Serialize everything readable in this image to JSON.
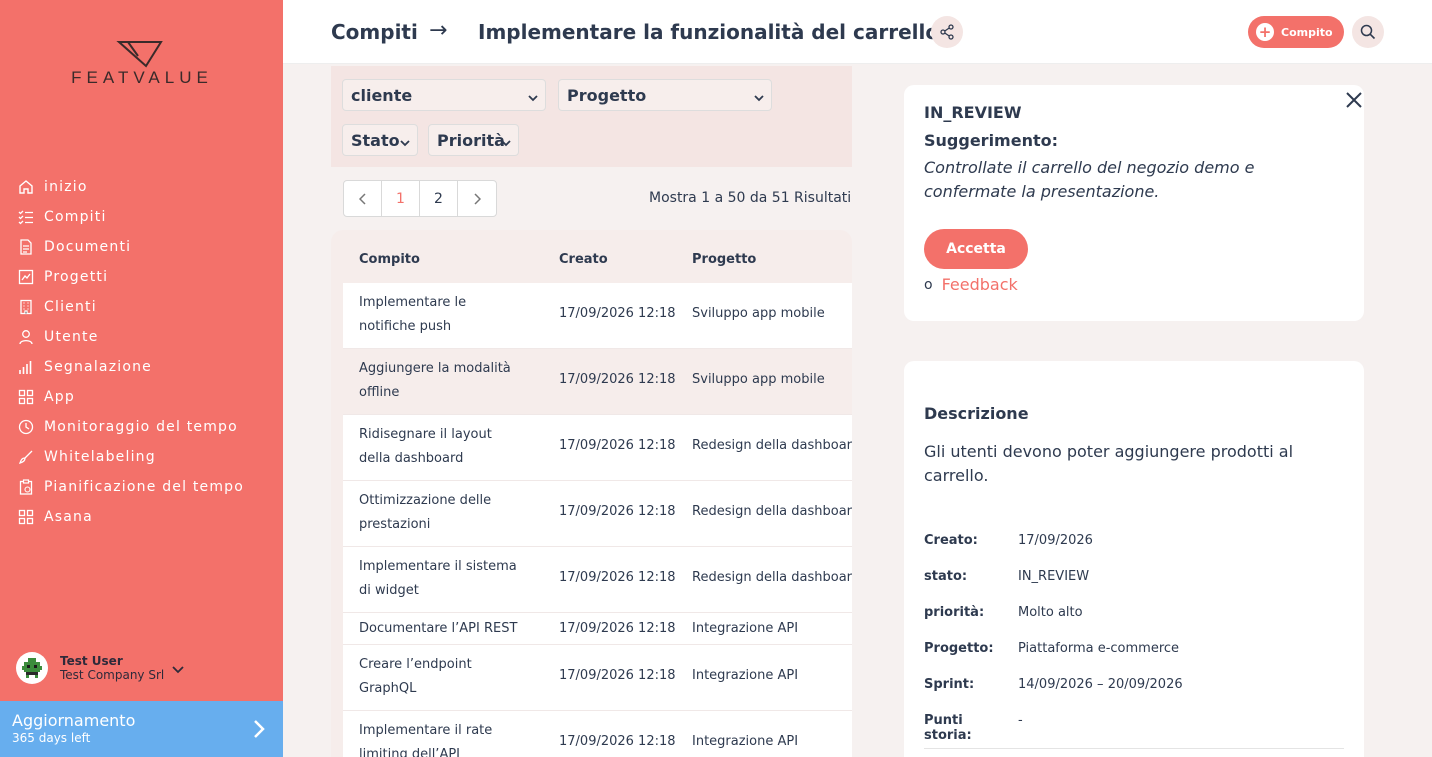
{
  "brand": {
    "name": "FEATVALUE",
    "accent": "#f3716a",
    "upgrade_color": "#67aeee"
  },
  "sidebar": {
    "items": [
      {
        "label": "inizio",
        "icon": "home-icon"
      },
      {
        "label": "Compiti",
        "icon": "checklist-icon"
      },
      {
        "label": "Documenti",
        "icon": "document-icon"
      },
      {
        "label": "Progetti",
        "icon": "chart-board-icon"
      },
      {
        "label": "Clienti",
        "icon": "building-icon"
      },
      {
        "label": "Utente",
        "icon": "user-icon"
      },
      {
        "label": "Segnalazione",
        "icon": "bar-chart-icon"
      },
      {
        "label": "App",
        "icon": "apps-icon"
      },
      {
        "label": "Monitoraggio del tempo",
        "icon": "clock-icon"
      },
      {
        "label": "Whitelabeling",
        "icon": "brush-icon"
      },
      {
        "label": "Pianificazione del tempo",
        "icon": "clipboard-icon"
      },
      {
        "label": "Asana",
        "icon": "apps-icon"
      }
    ],
    "user": {
      "name": "Test User",
      "company": "Test Company Srl"
    },
    "upgrade": {
      "title": "Aggiornamento",
      "subtitle": "365 days left"
    }
  },
  "header": {
    "root": "Compiti",
    "arrow": "→",
    "title": "Implementare la funzionalità del carrello",
    "add_label": "Compito"
  },
  "filters": {
    "client": "cliente",
    "project": "Progetto",
    "status": "Stato",
    "priority": "Priorità"
  },
  "pagination": {
    "prev": "‹",
    "pages": [
      "1",
      "2"
    ],
    "next": "›",
    "summary": "Mostra 1 a 50 da 51 Risultati"
  },
  "table": {
    "columns": [
      "Compito",
      "Creato",
      "Progetto"
    ],
    "rows": [
      {
        "task": "Implementare le notifiche push",
        "created": "17/09/2026 12:18",
        "project": "Sviluppo app mobile",
        "lines": 2
      },
      {
        "task": "Aggiungere la modalità offline",
        "created": "17/09/2026 12:18",
        "project": "Sviluppo app mobile",
        "lines": 2
      },
      {
        "task": "Ridisegnare il layout della dashboard",
        "created": "17/09/2026 12:18",
        "project": "Redesign della dashboard",
        "lines": 2
      },
      {
        "task": "Ottimizzazione delle prestazioni",
        "created": "17/09/2026 12:18",
        "project": "Redesign della dashboard",
        "lines": 2
      },
      {
        "task": "Implementare il sistema di widget",
        "created": "17/09/2026 12:18",
        "project": "Redesign della dashboard",
        "lines": 2
      },
      {
        "task": "Documentare l’API REST",
        "created": "17/09/2026 12:18",
        "project": "Integrazione API",
        "lines": 1
      },
      {
        "task": "Creare l’endpoint GraphQL",
        "created": "17/09/2026 12:18",
        "project": "Integrazione API",
        "lines": 2
      },
      {
        "task": "Implementare il rate limiting dell’API",
        "created": "17/09/2026 12:18",
        "project": "Integrazione API",
        "lines": 2
      }
    ]
  },
  "suggestion": {
    "status": "IN_REVIEW",
    "title": "Suggerimento:",
    "text": "Controllate il carrello del negozio demo e confermate la presentazione.",
    "accept_label": "Accetta",
    "bullet": "o",
    "feedback_label": "Feedback"
  },
  "details": {
    "title": "Descrizione",
    "text": "Gli utenti devono poter aggiungere prodotti al carrello.",
    "meta": [
      {
        "label": "Creato:",
        "value": "17/09/2026"
      },
      {
        "label": "stato:",
        "value": "IN_REVIEW"
      },
      {
        "label": "priorità:",
        "value": "Molto alto"
      },
      {
        "label": "Progetto:",
        "value": "Piattaforma e-commerce"
      },
      {
        "label": "Sprint:",
        "value": "14/09/2026 – 20/09/2026"
      },
      {
        "label": "Punti storia:",
        "value": "-"
      }
    ]
  }
}
